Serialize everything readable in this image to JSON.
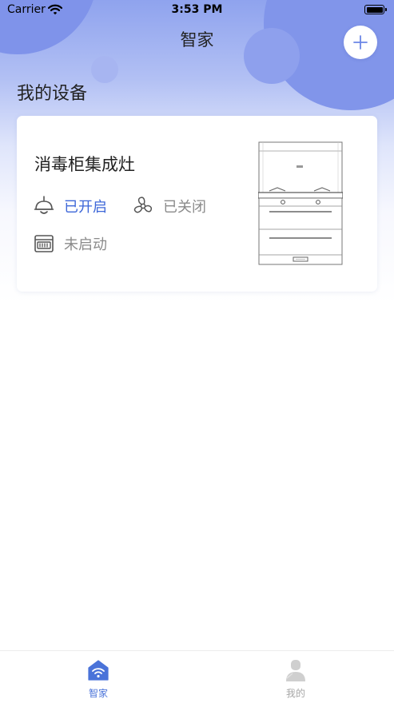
{
  "status_bar": {
    "carrier": "Carrier",
    "time": "3:53 PM"
  },
  "nav": {
    "title": "智家",
    "add_icon": "plus-icon"
  },
  "section": {
    "title": "我的设备"
  },
  "device": {
    "name": "消毒柜集成灶",
    "features": [
      {
        "icon": "lamp-icon",
        "label": "已开启",
        "state": "on"
      },
      {
        "icon": "fan-icon",
        "label": "已关闭",
        "state": "off"
      },
      {
        "icon": "sterilizer-icon",
        "label": "未启动",
        "state": "off"
      }
    ]
  },
  "tabbar": {
    "items": [
      {
        "label": "智家",
        "icon": "home-wifi-icon",
        "active": true
      },
      {
        "label": "我的",
        "icon": "person-icon",
        "active": false
      }
    ]
  },
  "colors": {
    "accent": "#3d67d8",
    "inactive": "#8a8a8a",
    "header_gradient": "#8fa3ee"
  }
}
